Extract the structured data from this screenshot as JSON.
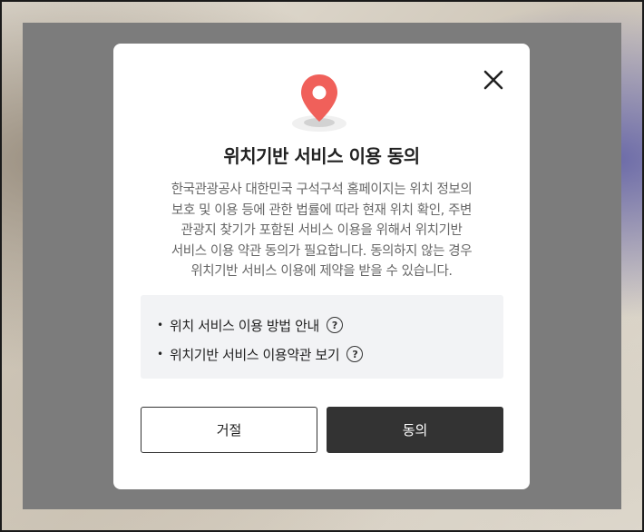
{
  "dialog": {
    "title": "위치기반 서비스 이용 동의",
    "description_lines": [
      "한국관광공사 대한민국 구석구석 홈페이지는 위치 정보의",
      "보호 및 이용 등에 관한 법률에 따라 현재 위치 확인, 주변",
      "관광지 찾기가 포함된 서비스 이용을 위해서 위치기반",
      "서비스 이용 약관 동의가 필요합니다. 동의하지 않는 경우",
      "위치기반 서비스 이용에 제약을 받을 수 있습니다."
    ],
    "links": [
      {
        "bullet": "•",
        "label": "위치 서비스 이용 방법 안내",
        "help": "?"
      },
      {
        "bullet": "•",
        "label": "위치기반 서비스 이용약관 보기",
        "help": "?"
      }
    ],
    "reject_label": "거절",
    "agree_label": "동의",
    "close_icon": "close-icon",
    "pin_icon": "location-pin-icon"
  },
  "colors": {
    "overlay": "#7c7c7c",
    "pin": "#f0605a",
    "agree_bg": "#333333"
  }
}
